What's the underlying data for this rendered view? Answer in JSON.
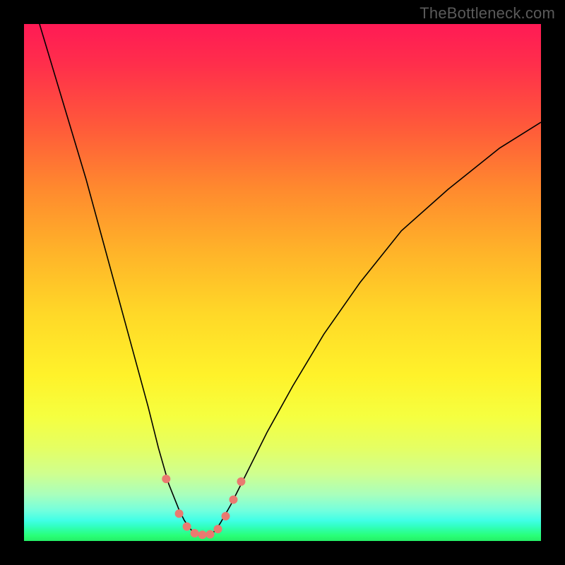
{
  "watermark": "TheBottleneck.com",
  "chart_data": {
    "type": "line",
    "title": "",
    "xlabel": "",
    "ylabel": "",
    "xlim": [
      0,
      100
    ],
    "ylim": [
      0,
      100
    ],
    "background": "vertical rainbow gradient, red(top) to green(bottom)",
    "series": [
      {
        "name": "curve",
        "x": [
          3,
          6,
          9,
          12,
          15,
          18,
          21,
          24,
          26,
          28,
          30,
          31,
          32,
          33,
          34,
          35,
          36,
          37,
          38,
          40,
          43,
          47,
          52,
          58,
          65,
          73,
          82,
          92,
          100
        ],
        "y": [
          100,
          90,
          80,
          70,
          59,
          48,
          37,
          26,
          18,
          11,
          6,
          4,
          2.5,
          1.5,
          1.0,
          1.0,
          1.2,
          2,
          3.5,
          7,
          13,
          21,
          30,
          40,
          50,
          60,
          68,
          76,
          81
        ],
        "stroke": "#000000",
        "stroke_width": 1.6
      }
    ],
    "markers": [
      {
        "x": 27.5,
        "y": 12,
        "r": 6,
        "fill": "#ea7a70"
      },
      {
        "x": 30.0,
        "y": 5.3,
        "r": 6,
        "fill": "#ea7a70"
      },
      {
        "x": 31.5,
        "y": 2.8,
        "r": 6,
        "fill": "#ea7a70"
      },
      {
        "x": 33.0,
        "y": 1.5,
        "r": 6,
        "fill": "#ea7a70"
      },
      {
        "x": 34.5,
        "y": 1.2,
        "r": 6,
        "fill": "#ea7a70"
      },
      {
        "x": 36.0,
        "y": 1.3,
        "r": 6,
        "fill": "#ea7a70"
      },
      {
        "x": 37.5,
        "y": 2.3,
        "r": 6,
        "fill": "#ea7a70"
      },
      {
        "x": 39.0,
        "y": 4.8,
        "r": 6,
        "fill": "#ea7a70"
      },
      {
        "x": 40.5,
        "y": 8.0,
        "r": 6,
        "fill": "#ea7a70"
      },
      {
        "x": 42.0,
        "y": 11.5,
        "r": 6,
        "fill": "#ea7a70"
      }
    ]
  }
}
